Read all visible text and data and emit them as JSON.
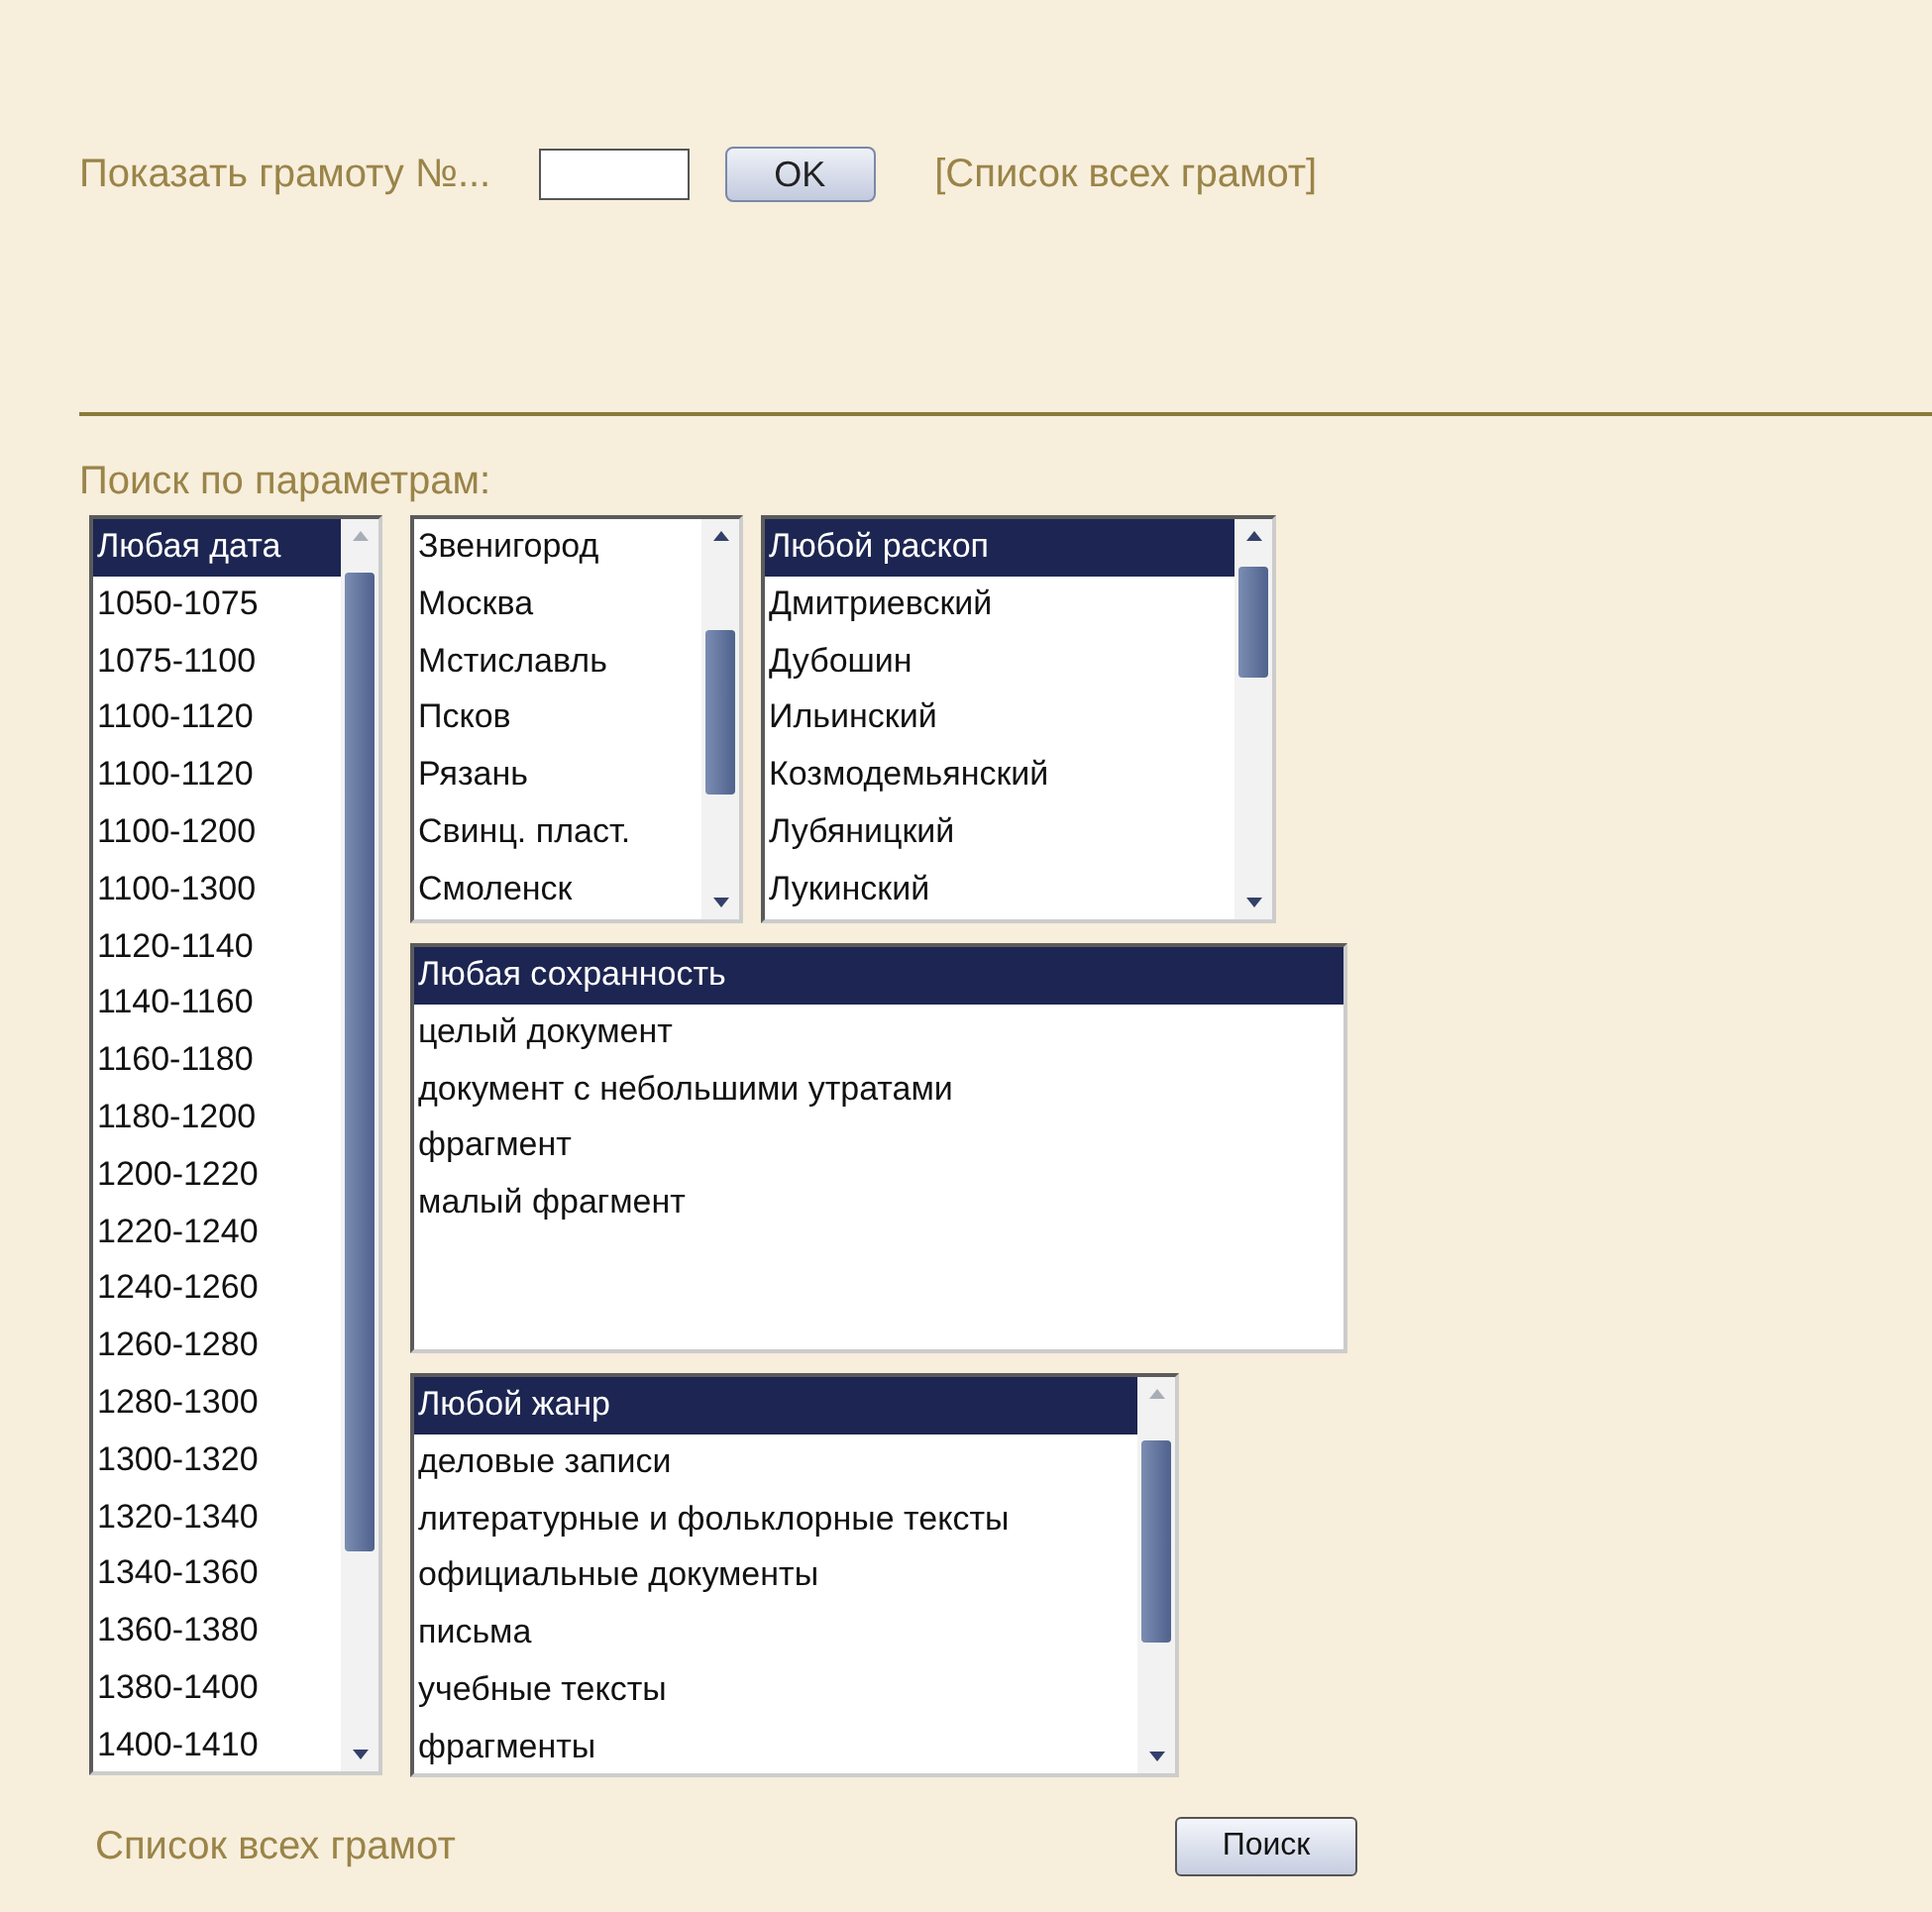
{
  "header": {
    "label": "Показать грамоту №...",
    "ok_button": "OK",
    "list_link": "[Список всех грамот]"
  },
  "search_title": "Поиск по параметрам:",
  "dates": {
    "scrollable": true,
    "items": [
      {
        "label": "Любая дата",
        "selected": true
      },
      {
        "label": "1050-1075",
        "selected": false
      },
      {
        "label": "1075-1100",
        "selected": false
      },
      {
        "label": "1100-1120",
        "selected": false
      },
      {
        "label": "1100-1120",
        "selected": false
      },
      {
        "label": "1100-1200",
        "selected": false
      },
      {
        "label": "1100-1300",
        "selected": false
      },
      {
        "label": "1120-1140",
        "selected": false
      },
      {
        "label": "1140-1160",
        "selected": false
      },
      {
        "label": "1160-1180",
        "selected": false
      },
      {
        "label": "1180-1200",
        "selected": false
      },
      {
        "label": "1200-1220",
        "selected": false
      },
      {
        "label": "1220-1240",
        "selected": false
      },
      {
        "label": "1240-1260",
        "selected": false
      },
      {
        "label": "1260-1280",
        "selected": false
      },
      {
        "label": "1280-1300",
        "selected": false
      },
      {
        "label": "1300-1320",
        "selected": false
      },
      {
        "label": "1320-1340",
        "selected": false
      },
      {
        "label": "1340-1360",
        "selected": false
      },
      {
        "label": "1360-1380",
        "selected": false
      },
      {
        "label": "1380-1400",
        "selected": false
      },
      {
        "label": "1400-1410",
        "selected": false
      }
    ]
  },
  "cities": {
    "scrollable": true,
    "items": [
      {
        "label": "Звенигород",
        "selected": false
      },
      {
        "label": "Москва",
        "selected": false
      },
      {
        "label": "Мстиславль",
        "selected": false
      },
      {
        "label": "Псков",
        "selected": false
      },
      {
        "label": "Рязань",
        "selected": false
      },
      {
        "label": "Свинц. пласт.",
        "selected": false
      },
      {
        "label": "Смоленск",
        "selected": false
      }
    ]
  },
  "excavations": {
    "scrollable": true,
    "items": [
      {
        "label": "Любой раскоп",
        "selected": true
      },
      {
        "label": "Дмитриевский",
        "selected": false
      },
      {
        "label": "Дубошин",
        "selected": false
      },
      {
        "label": "Ильинский",
        "selected": false
      },
      {
        "label": "Козмодемьянский",
        "selected": false
      },
      {
        "label": "Лубяницкий",
        "selected": false
      },
      {
        "label": "Лукинский",
        "selected": false
      }
    ]
  },
  "preservation": {
    "scrollable": false,
    "items": [
      {
        "label": "Любая сохранность",
        "selected": true
      },
      {
        "label": "целый документ",
        "selected": false
      },
      {
        "label": "документ с небольшими утратами",
        "selected": false
      },
      {
        "label": "фрагмент",
        "selected": false
      },
      {
        "label": "малый фрагмент",
        "selected": false
      }
    ]
  },
  "genres": {
    "scrollable": true,
    "items": [
      {
        "label": "Любой жанр",
        "selected": true
      },
      {
        "label": "деловые записи",
        "selected": false
      },
      {
        "label": "литературные и фольклорные тексты",
        "selected": false
      },
      {
        "label": "официальные документы",
        "selected": false
      },
      {
        "label": "письма",
        "selected": false
      },
      {
        "label": "учебные тексты",
        "selected": false
      },
      {
        "label": "фрагменты",
        "selected": false
      }
    ]
  },
  "footer": {
    "list_link": "Список всех грамот",
    "search_button": "Поиск"
  }
}
